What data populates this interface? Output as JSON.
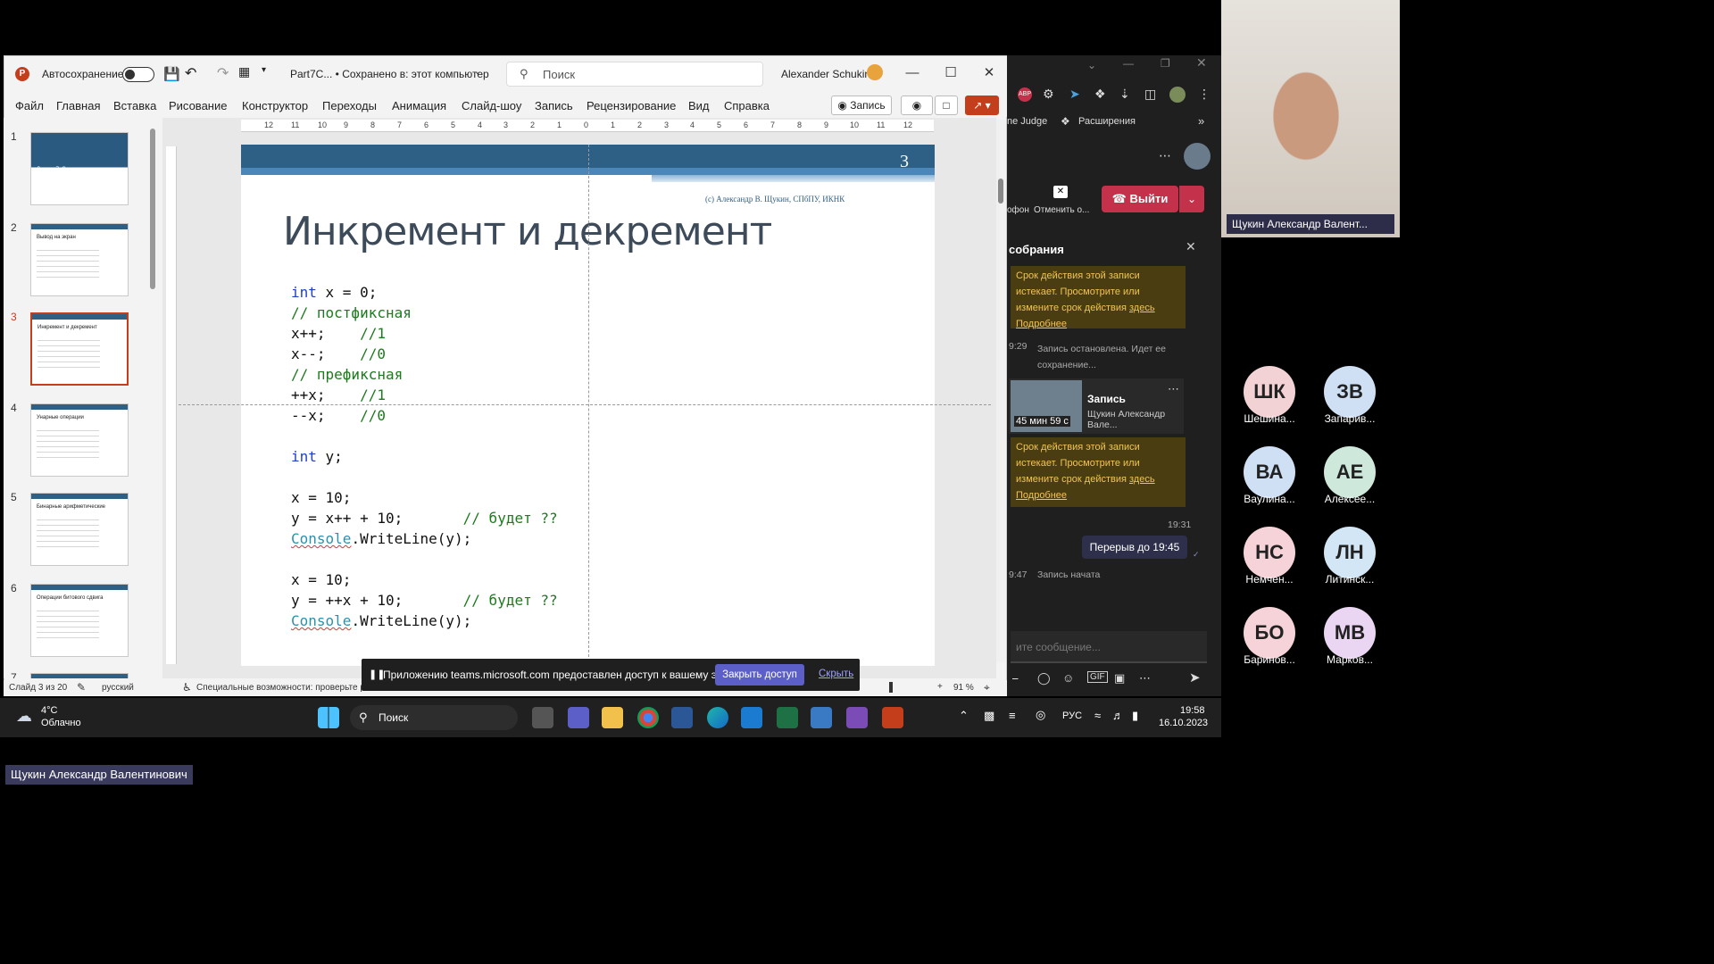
{
  "ppt": {
    "autosave_label": "Автосохранение",
    "file_name": "Part7C... • Сохранено в: этот компьютер",
    "search_placeholder": "Поиск",
    "user": "Alexander Schukin",
    "tabs": [
      "Файл",
      "Главная",
      "Вставка",
      "Рисование",
      "Конструктор",
      "Переходы",
      "Анимация",
      "Слайд-шоу",
      "Запись",
      "Рецензирование",
      "Вид",
      "Справка"
    ],
    "record_button": "Запись",
    "ruler_labels": [
      "12",
      "11",
      "10",
      "9",
      "8",
      "7",
      "6",
      "5",
      "4",
      "3",
      "2",
      "1",
      "0",
      "1",
      "2",
      "3",
      "4",
      "5",
      "6",
      "7",
      "8",
      "9",
      "10",
      "11",
      "12"
    ],
    "thumbnails": [
      {
        "num": "1",
        "title": "Лекция 7. Операции"
      },
      {
        "num": "2",
        "title": "Вывод на экран"
      },
      {
        "num": "3",
        "title": "Инкремент и декремент"
      },
      {
        "num": "4",
        "title": "Унарные операции"
      },
      {
        "num": "5",
        "title": "Бинарные арифметические"
      },
      {
        "num": "6",
        "title": "Операции битового сдвига"
      },
      {
        "num": "7",
        "title": ""
      }
    ],
    "status": {
      "slide": "Слайд 3 из 20",
      "language": "русский",
      "accessibility": "Специальные возможности: проверьте рек",
      "zoom": "91 %"
    }
  },
  "slide": {
    "number": "3",
    "credit": "(c) Александр В. Щукин, СПбПУ, ИКНК",
    "title": "Инкремент и декремент",
    "code": {
      "l1_kw": "int",
      "l1_rest": " x = 0;",
      "l2": "// постфиксная",
      "l3": "x++;    ",
      "l3_cm": "//1",
      "l4": "x--;    ",
      "l4_cm": "//0",
      "l5": "// префиксная",
      "l6": "++x;    ",
      "l6_cm": "//1",
      "l7": "--x;    ",
      "l7_cm": "//0",
      "l8_kw": "int",
      "l8_rest": " y;",
      "l9": "x = 10;",
      "l10": "y = x++ + 10;       ",
      "l10_cm": "// будет ??",
      "l11_cls": "Console",
      "l11_rest": ".WriteLine(y);",
      "l12": "x = 10;",
      "l13": "y = ++x + 10;       ",
      "l13_cm": "// будет ??",
      "l14_cls": "Console",
      "l14_rest": ".WriteLine(y);"
    }
  },
  "share_bar": {
    "message": "Приложению teams.microsoft.com предоставлен доступ к вашему экрану.",
    "stop_button": "Закрыть доступ",
    "hide_link": "Скрыть"
  },
  "teams": {
    "judge": "ne Judge",
    "extensions": "Расширения",
    "mic_label": "офон",
    "cancel_label": "Отменить о...",
    "leave_button": "Выйти",
    "panel_title": "собрания",
    "notice1": {
      "text": "Срок действия этой записи истекает. Просмотрите или измените срок действия ",
      "link": "здесь",
      "more": "Подробнее"
    },
    "event1": {
      "time": "9:29",
      "text": "Запись остановлена. Идет ее сохранение..."
    },
    "recording": {
      "duration": "45 мин 59 с",
      "title": "Запись",
      "author": "Щукин Александр Вале..."
    },
    "notice2": {
      "text": "Срок действия этой записи истекает. Просмотрите или измените срок действия ",
      "link": "здесь",
      "more": "Подробнее"
    },
    "msg_time": "19:31",
    "msg_text": "Перерыв до 19:45",
    "event2": {
      "time": "9:47",
      "text": "Запись начата"
    },
    "composer_placeholder": "ите сообщение..."
  },
  "people": {
    "camera_name": "Щукин Александр Валент...",
    "participants": [
      {
        "initials": "ШК",
        "name": "Шешина...",
        "color": "#f2d2d5"
      },
      {
        "initials": "ЗВ",
        "name": "Запарив...",
        "color": "#cfe0f5"
      },
      {
        "initials": "ВА",
        "name": "Вaулина...",
        "color": "#cfe0f5"
      },
      {
        "initials": "АЕ",
        "name": "Алексее...",
        "color": "#cfe8dc"
      },
      {
        "initials": "НС",
        "name": "Немчен...",
        "color": "#f5d3d8"
      },
      {
        "initials": "ЛН",
        "name": "Литинск...",
        "color": "#d3e6f5"
      },
      {
        "initials": "БО",
        "name": "Баринов...",
        "color": "#f5d3d8"
      },
      {
        "initials": "МВ",
        "name": "Марков...",
        "color": "#ead6f2"
      }
    ]
  },
  "taskbar": {
    "weather_temp": "4°C",
    "weather_desc": "Облачно",
    "search": "Поиск",
    "lang": "РУС",
    "time": "19:58",
    "date": "16.10.2023"
  },
  "speaker_label": "Щукин Александр Валентинович"
}
